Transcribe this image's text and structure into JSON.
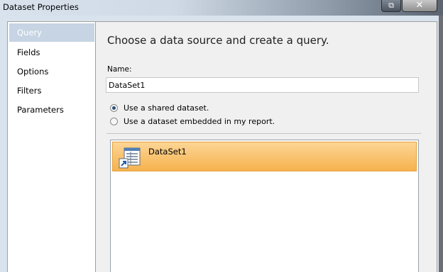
{
  "window": {
    "title": "Dataset Properties",
    "minimize_glyph": "⧉",
    "close_glyph": "✕"
  },
  "sidebar": {
    "items": [
      {
        "label": "Query",
        "selected": true
      },
      {
        "label": "Fields",
        "selected": false
      },
      {
        "label": "Options",
        "selected": false
      },
      {
        "label": "Filters",
        "selected": false
      },
      {
        "label": "Parameters",
        "selected": false
      }
    ]
  },
  "main": {
    "heading": "Choose a data source and create a query.",
    "name_label": "Name:",
    "name_value": "DataSet1",
    "radios": [
      {
        "label": "Use a shared dataset.",
        "checked": true
      },
      {
        "label": "Use a dataset embedded in my report.",
        "checked": false
      }
    ],
    "datasets": [
      {
        "label": "DataSet1",
        "icon": "shared-dataset-icon",
        "selected": true
      }
    ]
  },
  "colors": {
    "selection_top": "#fcd596",
    "selection_bottom": "#f6b24e",
    "nav_selected": "#c6d4e3"
  }
}
